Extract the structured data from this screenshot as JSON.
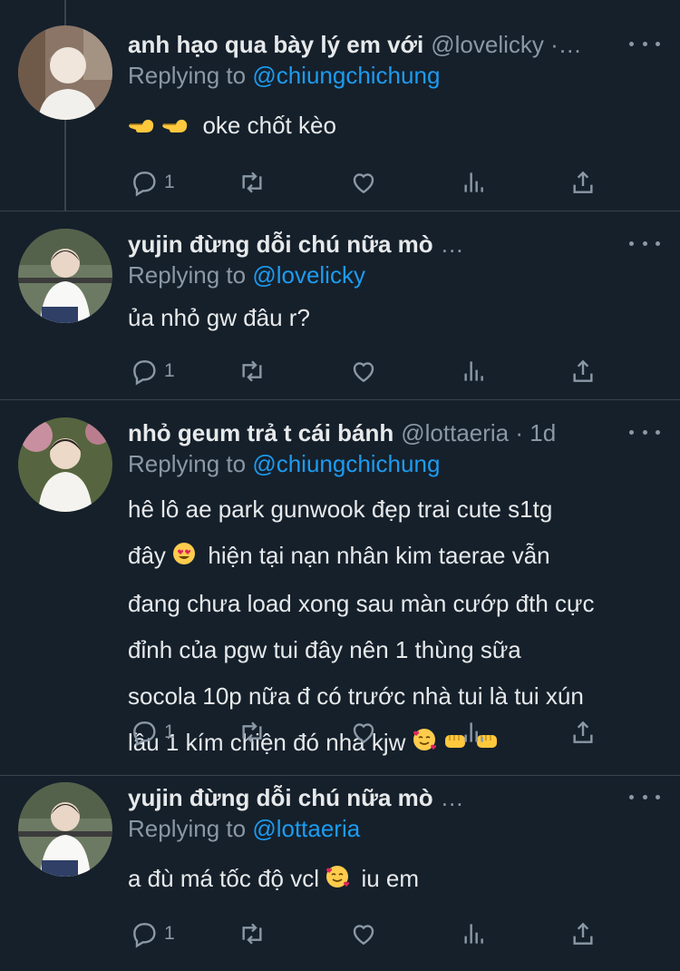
{
  "tweets": [
    {
      "name": "anh hạo qua bày lý em với",
      "handle": "@lovelicky ·…",
      "replying_label": "Replying to",
      "replying_to": "@chiungchichung",
      "text": "oke chốt kèo",
      "reply_count": "1",
      "avatar_colors": [
        "#6f5a4a",
        "#e8e3dc",
        "#cfc8c0"
      ]
    },
    {
      "name": "yujin đừng dỗi chú nữa mò",
      "handle": "…",
      "replying_label": "Replying to",
      "replying_to": "@lovelicky",
      "text": "ủa nhỏ gw đâu r?",
      "reply_count": "1",
      "avatar_colors": [
        "#5e6b54",
        "#ffffff",
        "#2a2a2a"
      ]
    },
    {
      "name": "nhỏ geum trả t cái bánh",
      "handle": "@lottaeria · 1d",
      "replying_label": "Replying to",
      "replying_to": "@chiungchichung",
      "text_lines": [
        "hê lô ae park gunwook đẹp trai cute s1tg",
        "đây",
        "hiện tại nạn nhân kim taerae vẫn",
        "đang chưa load xong sau màn cướp đth cực",
        "đỉnh của pgw tui đây nên 1 thùng sữa",
        "socola 10p nữa đ có trước nhà tui là tui xún",
        "lầu 1 kím chiện đó nha kjw"
      ],
      "reply_count": "1",
      "avatar_colors": [
        "#4f5c3f",
        "#f2efe9",
        "#2b2420"
      ]
    },
    {
      "name": "yujin đừng dỗi chú nữa mò",
      "handle": "…",
      "replying_label": "Replying to",
      "replying_to": "@lottaeria",
      "text_a": "a đù má tốc độ vcl",
      "text_b": "iu em",
      "reply_count": "1",
      "avatar_colors": [
        "#5e6b54",
        "#ffffff",
        "#2a2a2a"
      ]
    }
  ],
  "icons": {
    "reply": "reply-icon",
    "retweet": "retweet-icon",
    "like": "heart-icon",
    "views": "views-icon",
    "share": "share-icon",
    "more": "more-icon"
  },
  "colors": {
    "background": "#15202b",
    "text": "#e7e9ea",
    "secondary": "#8b98a5",
    "link": "#1d9bf0",
    "divider": "#38444d"
  }
}
